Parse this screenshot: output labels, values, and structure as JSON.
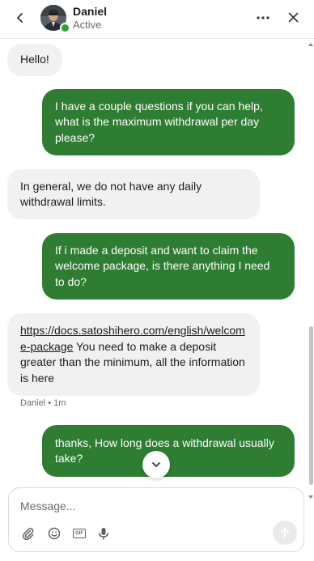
{
  "header": {
    "contact_name": "Daniel",
    "status": "Active",
    "status_color": "#2e9d3a"
  },
  "messages": [
    {
      "direction": "incoming",
      "text": "Hello!"
    },
    {
      "direction": "outgoing",
      "text": "I have a couple questions if you can help, what is the maximum withdrawal per day please?"
    },
    {
      "direction": "incoming",
      "text": "In general, we do not have any daily withdrawal limits."
    },
    {
      "direction": "outgoing",
      "text": "If i made a deposit and want to claim the welcome package, is there anything I need to do?"
    },
    {
      "direction": "incoming",
      "link": "https://docs.satoshihero.com/english/welcome-package",
      "text": " You need to make a deposit greater than the minimum, all the information is here"
    },
    {
      "direction": "outgoing",
      "text": "thanks, How long does a withdrawal usually take?"
    }
  ],
  "message_meta": {
    "sender": "Daniel",
    "separator": "•",
    "time": "1m"
  },
  "composer": {
    "placeholder": "Message...",
    "value": ""
  },
  "colors": {
    "outgoing_bubble": "#2e7d32",
    "incoming_bubble": "#f1f1f1",
    "accent_green": "#2e7d32"
  },
  "icons": {
    "back": "chevron-left-icon",
    "more": "more-horizontal-icon",
    "close": "close-icon",
    "scroll_down": "chevron-down-icon",
    "attach": "paperclip-icon",
    "emoji": "emoji-icon",
    "gif": "gif-icon",
    "mic": "microphone-icon",
    "send": "send-arrow-icon"
  }
}
